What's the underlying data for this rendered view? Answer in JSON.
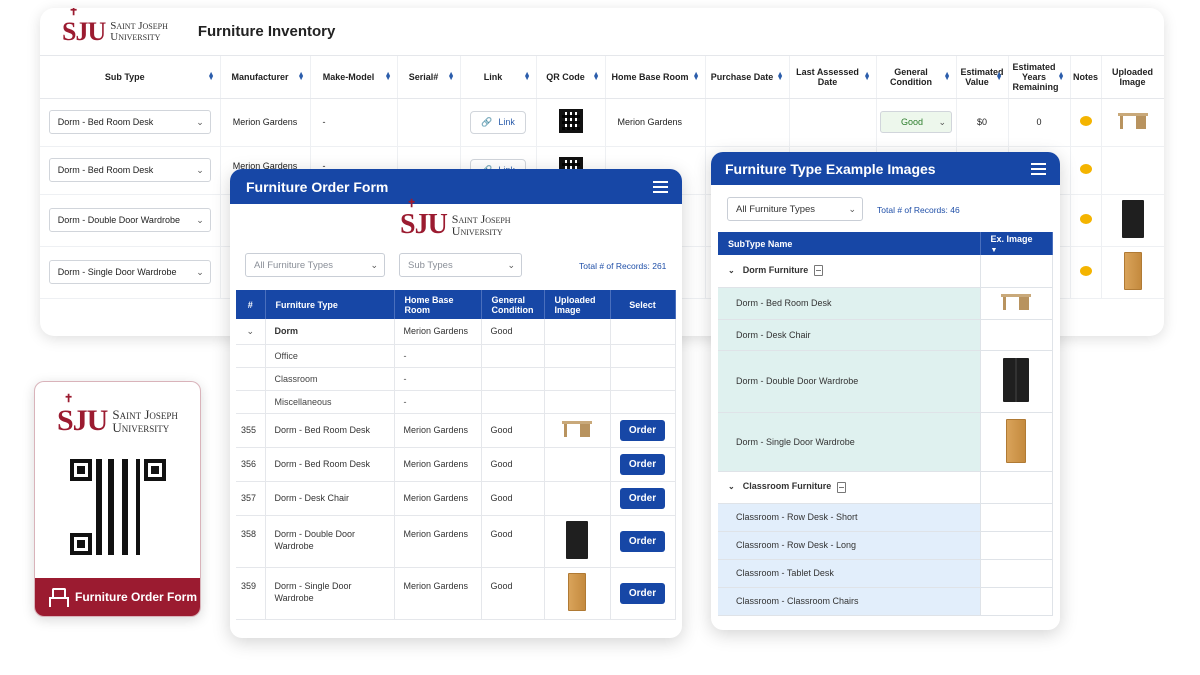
{
  "brand": {
    "logo_mark": "SJU",
    "logo_line1": "Saint Joseph",
    "logo_line2": "University",
    "primary_color": "#1747a6",
    "accent_color": "#9b1b30"
  },
  "inventory": {
    "title": "Furniture Inventory",
    "columns": [
      "Sub Type",
      "Manufacturer",
      "Make-Model",
      "Serial#",
      "Link",
      "QR Code",
      "Home Base Room",
      "Purchase Date",
      "Last Assessed Date",
      "General Condition",
      "Estimated Value",
      "Estimated Years Remaining",
      "Notes",
      "Uploaded Image"
    ],
    "rows": [
      {
        "sub_type": "Dorm - Bed Room Desk",
        "manufacturer": "Merion Gardens",
        "make_model": "-",
        "link": "Link",
        "home_base": "Merion Gardens",
        "condition": "Good",
        "value": "$0",
        "years": "0"
      },
      {
        "sub_type": "Dorm - Bed Room Desk",
        "manufacturer": "Merion Gardens",
        "make_model": "-",
        "link": "Link"
      },
      {
        "sub_type": "Dorm - Double Door Wardrobe"
      },
      {
        "sub_type": "Dorm - Single Door Wardrobe"
      }
    ]
  },
  "qr_card": {
    "footer_label": "Furniture Order Form"
  },
  "order_form": {
    "title": "Furniture Order Form",
    "filter_types_placeholder": "All Furniture Types",
    "filter_subtypes_placeholder": "Sub Types",
    "records_label": "Total # of Records: 261",
    "columns": [
      "#",
      "Furniture Type",
      "Home Base Room",
      "General Condition",
      "Uploaded Image",
      "Select"
    ],
    "group": {
      "name": "Dorm",
      "home_base": "Merion Gardens",
      "condition": "Good"
    },
    "subgroups": [
      {
        "name": "Office",
        "home_base": "-"
      },
      {
        "name": "Classroom",
        "home_base": "-"
      },
      {
        "name": "Miscellaneous",
        "home_base": "-"
      }
    ],
    "items": [
      {
        "id": "355",
        "type": "Dorm - Bed Room Desk",
        "home_base": "Merion Gardens",
        "condition": "Good",
        "image": "desk-icon",
        "action": "Order"
      },
      {
        "id": "356",
        "type": "Dorm - Bed Room Desk",
        "home_base": "Merion Gardens",
        "condition": "Good",
        "image": "",
        "action": "Order"
      },
      {
        "id": "357",
        "type": "Dorm - Desk Chair",
        "home_base": "Merion Gardens",
        "condition": "Good",
        "image": "",
        "action": "Order"
      },
      {
        "id": "358",
        "type": "Dorm - Double Door Wardrobe",
        "home_base": "Merion Gardens",
        "condition": "Good",
        "image": "dark-wardrobe-icon",
        "action": "Order"
      },
      {
        "id": "359",
        "type": "Dorm - Single Door Wardrobe",
        "home_base": "Merion Gardens",
        "condition": "Good",
        "image": "wood-wardrobe-icon",
        "action": "Order"
      }
    ]
  },
  "examples": {
    "title": "Furniture Type Example Images",
    "filter_placeholder": "All Furniture Types",
    "records_label": "Total # of Records: 46",
    "columns": [
      "SubType Name",
      "Ex. Image"
    ],
    "groups": [
      {
        "name": "Dorm Furniture",
        "items": [
          "Dorm - Bed Room Desk",
          "Dorm - Desk Chair",
          "Dorm - Double Door Wardrobe",
          "Dorm - Single Door Wardrobe"
        ]
      },
      {
        "name": "Classroom Furniture",
        "items": [
          "Classroom - Row Desk - Short",
          "Classroom - Row Desk - Long",
          "Classroom - Tablet Desk",
          "Classroom - Classroom Chairs"
        ]
      }
    ]
  }
}
